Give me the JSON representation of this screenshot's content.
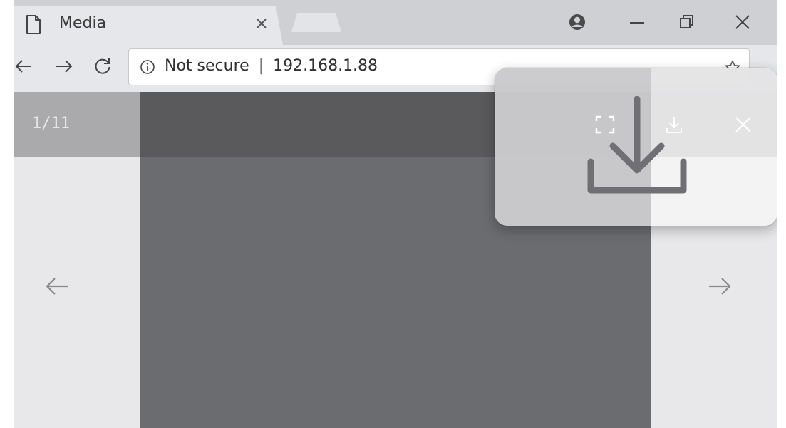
{
  "tab": {
    "title": "Media",
    "icon": "document-icon",
    "close_icon": "close-icon"
  },
  "window_controls": [
    "account-icon",
    "minimize-icon",
    "restore-icon",
    "close-icon"
  ],
  "toolbar": {
    "back_icon": "arrow-left-icon",
    "forward_icon": "arrow-right-icon",
    "reload_icon": "reload-icon",
    "security_label": "Not secure",
    "separator": "|",
    "url": "192.168.1.88",
    "bookmark_icon": "star-icon"
  },
  "viewer": {
    "counter": "1/11",
    "prev_icon": "arrow-left-icon",
    "next_icon": "arrow-right-icon",
    "header_icons": [
      "fullscreen-icon",
      "download-icon",
      "close-icon"
    ]
  },
  "popup": {
    "icon": "download-icon"
  },
  "colors": {
    "tab_strip": "#cfd0d3",
    "toolbar": "#e6e7ea",
    "media_header": "#5a5a5d",
    "media_area": "#6b6c70",
    "counter_bar": "#aaaaad",
    "side_panels": "#e8e8ea"
  }
}
